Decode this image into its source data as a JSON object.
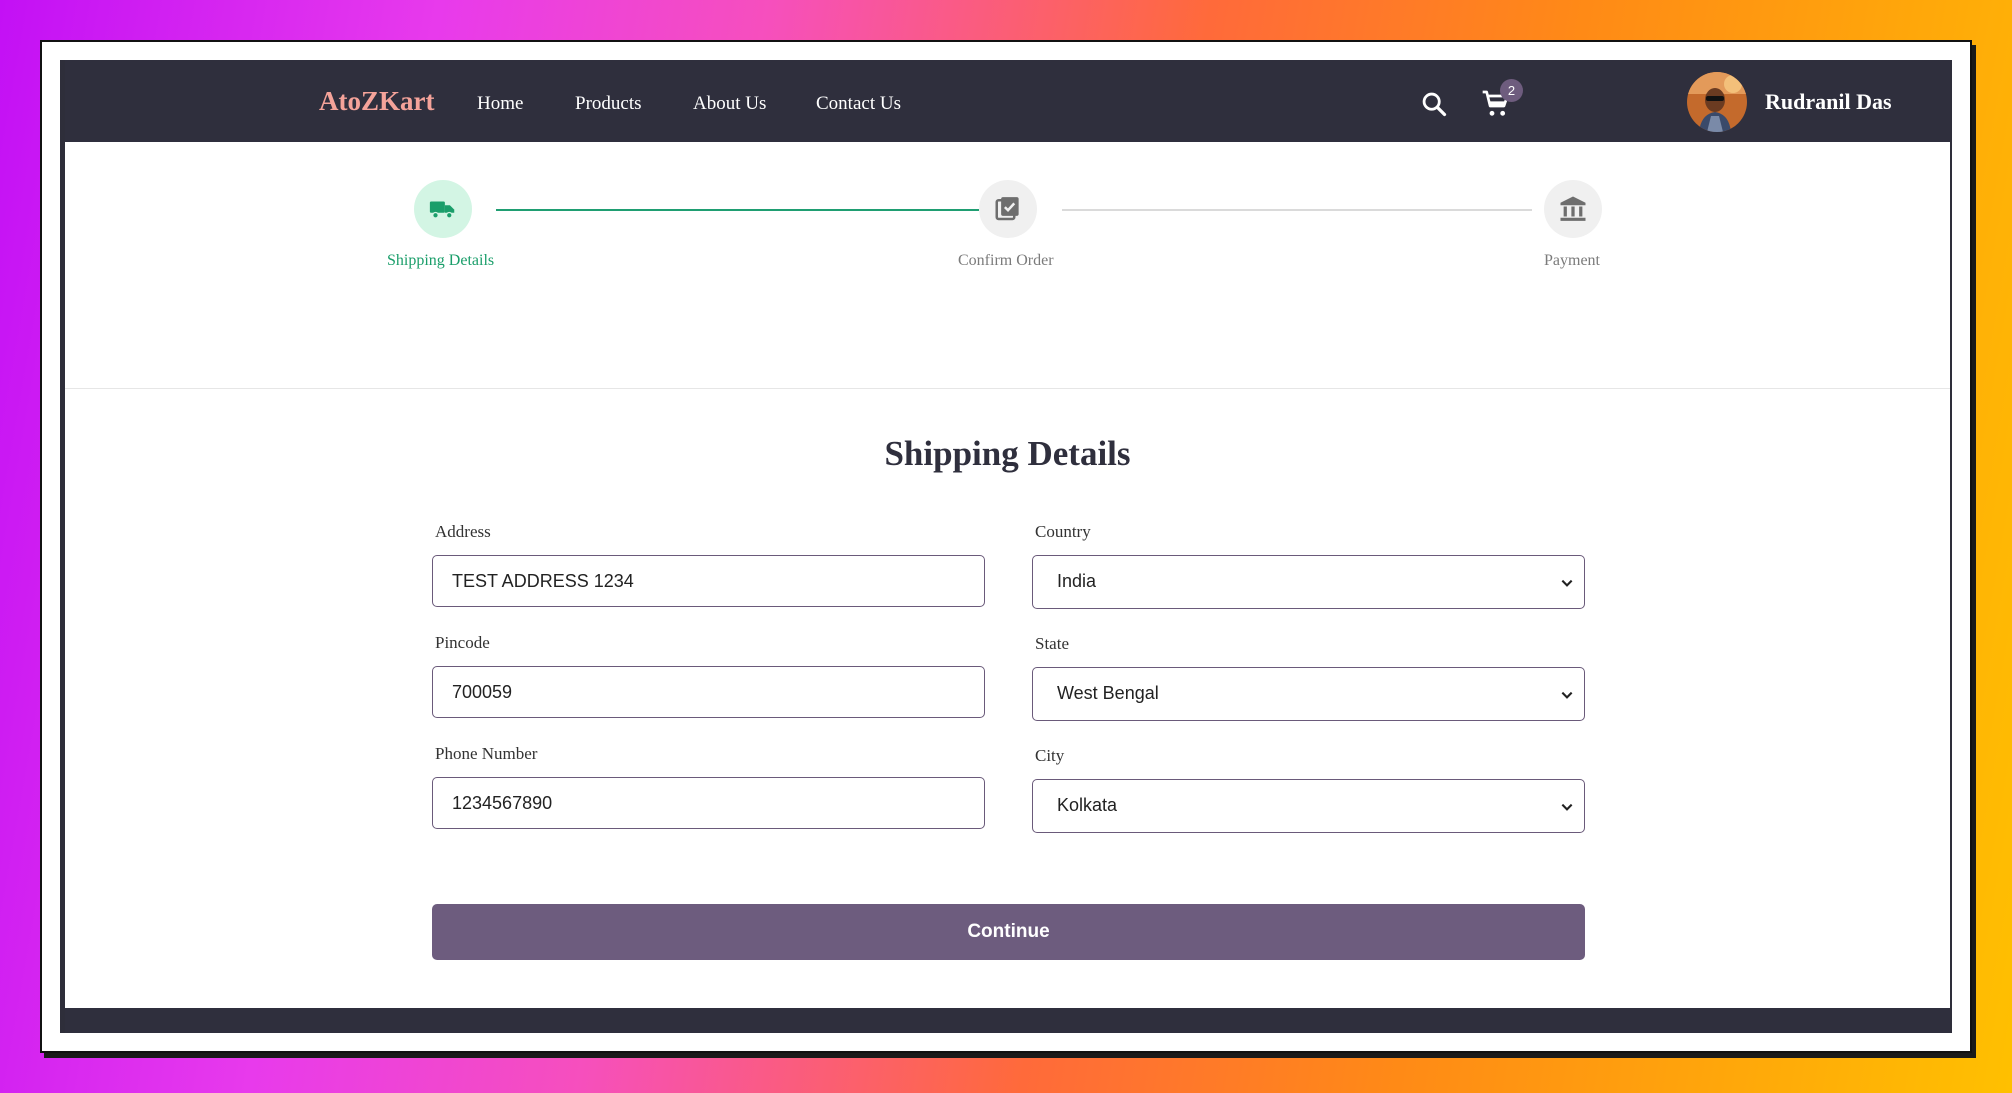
{
  "navbar": {
    "brand": "AtoZKart",
    "links": [
      "Home",
      "Products",
      "About Us",
      "Contact Us"
    ],
    "cart_count": "2",
    "user_name": "Rudranil Das"
  },
  "stepper": {
    "steps": [
      {
        "label": "Shipping Details",
        "icon": "truck-icon",
        "active": true
      },
      {
        "label": "Confirm Order",
        "icon": "checklist-icon",
        "active": false
      },
      {
        "label": "Payment",
        "icon": "bank-icon",
        "active": false
      }
    ]
  },
  "form": {
    "title": "Shipping Details",
    "address_label": "Address",
    "address_value": "TEST ADDRESS 1234",
    "pincode_label": "Pincode",
    "pincode_value": "700059",
    "phone_label": "Phone Number",
    "phone_value": "1234567890",
    "country_label": "Country",
    "country_value": "India",
    "state_label": "State",
    "state_value": "West Bengal",
    "city_label": "City",
    "city_value": "Kolkata",
    "continue_label": "Continue"
  },
  "colors": {
    "navbar_bg": "#2f2f3d",
    "brand": "#f5a39a",
    "active_step": "#1a9e6a",
    "button": "#6d5c7e"
  }
}
